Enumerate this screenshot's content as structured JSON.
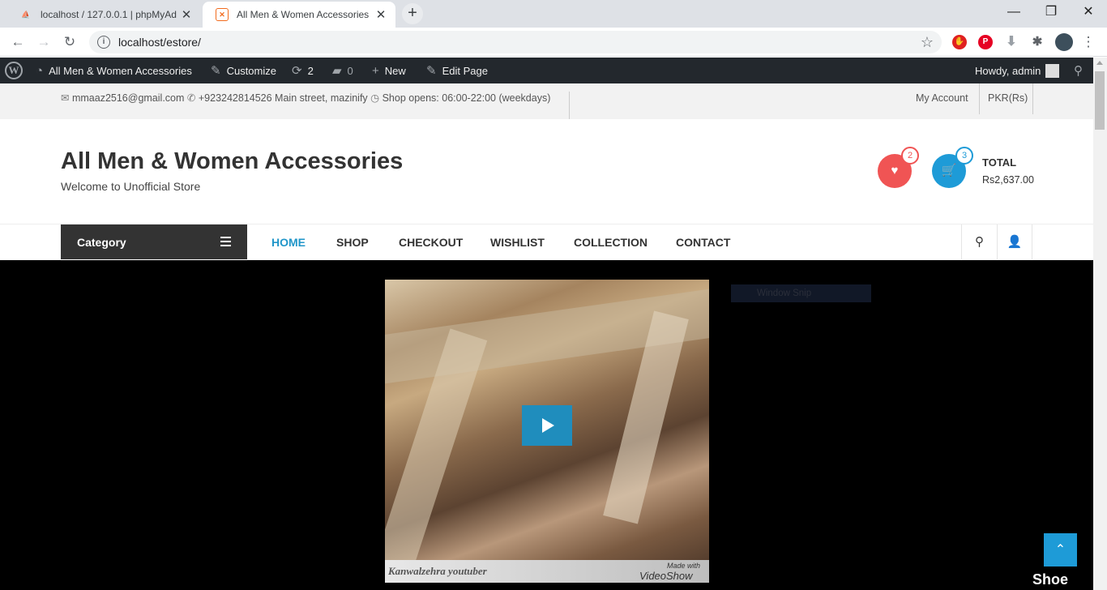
{
  "browser": {
    "tabs": [
      {
        "title": "localhost / 127.0.0.1 | phpMyAdmin",
        "favicon": "phpmyadmin-icon",
        "active": false
      },
      {
        "title": "All Men & Women Accessories – ",
        "favicon": "xampp-icon",
        "active": true
      }
    ],
    "address": "localhost/estore/",
    "window_controls": [
      "minimize",
      "restore",
      "close"
    ]
  },
  "admin_bar": {
    "site_name": "All Men & Women Accessories",
    "customize": "Customize",
    "updates_count": "2",
    "comments_count": "0",
    "new_label": "New",
    "edit_page": "Edit Page",
    "howdy": "Howdy, admin"
  },
  "topbar": {
    "email": "mmaaz2516@gmail.com",
    "phone_address": "+923242814526 Main street, mazinify",
    "hours": "Shop opens: 06:00-22:00 (weekdays)",
    "my_account": "My Account",
    "currency": "PKR(Rs)"
  },
  "header": {
    "site_title": "All Men & Women Accessories",
    "tagline": "Welcome to Unofficial Store",
    "wishlist_count": "2",
    "cart_count": "3",
    "total_label": "TOTAL",
    "total_value": "Rs2,637.00"
  },
  "nav": {
    "category_label": "Category",
    "links": [
      "HOME",
      "SHOP",
      "CHECKOUT",
      "WISHLIST",
      "COLLECTION",
      "CONTACT"
    ],
    "active_link": "HOME"
  },
  "hero": {
    "video_watermark_left": "Kanwalzehra youtuber",
    "video_watermark_made": "Made with",
    "video_watermark_brand": "VideoShow",
    "snip_label": "Window Snip",
    "side_text": "Shoe"
  },
  "colors": {
    "accent": "#2196c9",
    "admin_bar": "#23282d",
    "wishlist": "#f05454",
    "cart": "#1e9bd7"
  }
}
